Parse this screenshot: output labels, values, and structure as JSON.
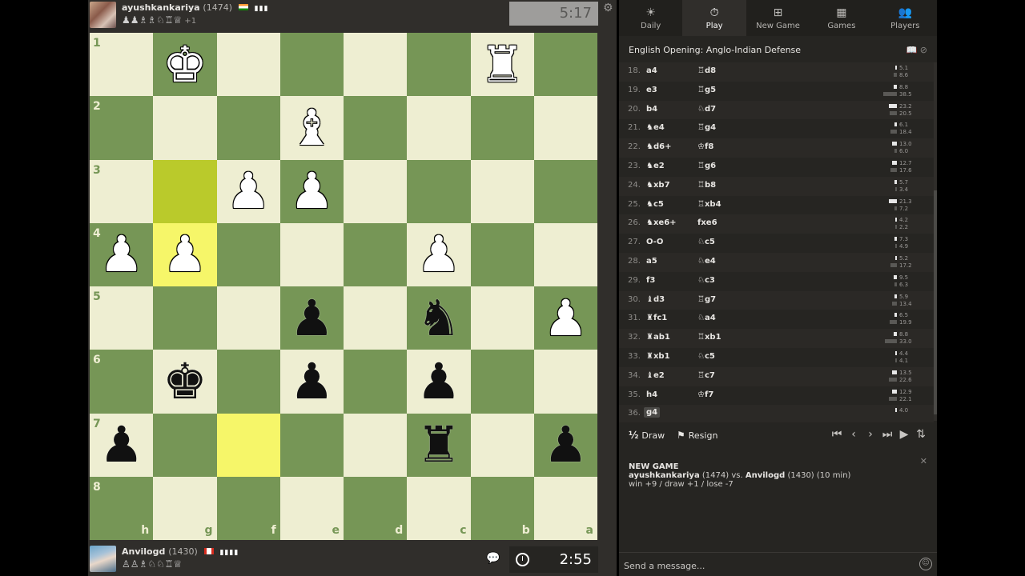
{
  "top_player": {
    "name": "ayushkankariya",
    "rating": "(1474)",
    "captured": "♟♟♗♗♘♖♕",
    "advantage": "+1",
    "clock": "5:17"
  },
  "bottom_player": {
    "name": "Anvilogd",
    "rating": "(1430)",
    "captured": "♙♙♗♘♘♖♕",
    "clock": "2:55"
  },
  "board": {
    "ranks": [
      "1",
      "2",
      "3",
      "4",
      "5",
      "6",
      "7",
      "8"
    ],
    "files": [
      "h",
      "g",
      "f",
      "e",
      "d",
      "c",
      "b",
      "a"
    ],
    "rows": [
      [
        "",
        "wk",
        "",
        "",
        "",
        "",
        "wr",
        ""
      ],
      [
        "",
        "",
        "",
        "wb",
        "",
        "",
        "",
        ""
      ],
      [
        "",
        "",
        "wp",
        "wp",
        "",
        "",
        "",
        ""
      ],
      [
        "wp",
        "wp",
        "",
        "",
        "",
        "wp",
        "",
        ""
      ],
      [
        "",
        "",
        "",
        "bp",
        "",
        "bn",
        "",
        "wp"
      ],
      [
        "",
        "bk",
        "",
        "bp",
        "",
        "bp",
        "",
        ""
      ],
      [
        "bp",
        "",
        "",
        "",
        "",
        "br",
        "",
        "bp"
      ],
      [
        "",
        "",
        "",
        "",
        "",
        "",
        "",
        ""
      ]
    ],
    "highlight_squares": [
      "2,1",
      "3,1",
      "6,2"
    ],
    "colors": {
      "light": "#eeeed2",
      "dark": "#769656",
      "highlight_light": "#f6f669",
      "highlight_dark": "#baca2b"
    }
  },
  "nav_tabs": [
    {
      "label": "Daily",
      "icon": "sun-icon"
    },
    {
      "label": "Play",
      "icon": "stopwatch-icon"
    },
    {
      "label": "New Game",
      "icon": "plus-icon"
    },
    {
      "label": "Games",
      "icon": "chessboard-icon"
    },
    {
      "label": "Players",
      "icon": "people-icon"
    }
  ],
  "opening": "English Opening: Anglo-Indian Defense",
  "moves": [
    {
      "n": "18.",
      "w": "a4",
      "b": "♖d8",
      "wt": "5.1",
      "bt": "8.6",
      "wv": 5.1,
      "bv": 8.6
    },
    {
      "n": "19.",
      "w": "e3",
      "b": "♖g5",
      "wt": "8.8",
      "bt": "38.5",
      "wv": 8.8,
      "bv": 38.5
    },
    {
      "n": "20.",
      "w": "b4",
      "b": "♘d7",
      "wt": "23.2",
      "bt": "20.5",
      "wv": 23.2,
      "bv": 20.5
    },
    {
      "n": "21.",
      "w": "♞e4",
      "b": "♖g4",
      "wt": "6.1",
      "bt": "18.4",
      "wv": 6.1,
      "bv": 18.4
    },
    {
      "n": "22.",
      "w": "♞d6+",
      "b": "♔f8",
      "wt": "13.0",
      "bt": "6.0",
      "wv": 13.0,
      "bv": 6.0
    },
    {
      "n": "23.",
      "w": "♞e2",
      "b": "♖g6",
      "wt": "12.7",
      "bt": "17.6",
      "wv": 12.7,
      "bv": 17.6
    },
    {
      "n": "24.",
      "w": "♞xb7",
      "b": "♖b8",
      "wt": "5.7",
      "bt": "3.4",
      "wv": 5.7,
      "bv": 3.4
    },
    {
      "n": "25.",
      "w": "♞c5",
      "b": "♖xb4",
      "wt": "21.3",
      "bt": "7.2",
      "wv": 21.3,
      "bv": 7.2
    },
    {
      "n": "26.",
      "w": "♞xe6+",
      "b": "fxe6",
      "wt": "4.2",
      "bt": "2.2",
      "wv": 4.2,
      "bv": 2.2
    },
    {
      "n": "27.",
      "w": "O-O",
      "b": "♘c5",
      "wt": "7.3",
      "bt": "4.9",
      "wv": 7.3,
      "bv": 4.9
    },
    {
      "n": "28.",
      "w": "a5",
      "b": "♘e4",
      "wt": "5.2",
      "bt": "17.2",
      "wv": 5.2,
      "bv": 17.2
    },
    {
      "n": "29.",
      "w": "f3",
      "b": "♘c3",
      "wt": "9.5",
      "bt": "6.3",
      "wv": 9.5,
      "bv": 6.3
    },
    {
      "n": "30.",
      "w": "♝d3",
      "b": "♖g7",
      "wt": "5.9",
      "bt": "13.4",
      "wv": 5.9,
      "bv": 13.4
    },
    {
      "n": "31.",
      "w": "♜fc1",
      "b": "♘a4",
      "wt": "6.5",
      "bt": "19.9",
      "wv": 6.5,
      "bv": 19.9
    },
    {
      "n": "32.",
      "w": "♜ab1",
      "b": "♖xb1",
      "wt": "8.8",
      "bt": "33.0",
      "wv": 8.8,
      "bv": 33.0
    },
    {
      "n": "33.",
      "w": "♜xb1",
      "b": "♘c5",
      "wt": "4.4",
      "bt": "4.1",
      "wv": 4.4,
      "bv": 4.1
    },
    {
      "n": "34.",
      "w": "♝e2",
      "b": "♖c7",
      "wt": "13.5",
      "bt": "22.6",
      "wv": 13.5,
      "bv": 22.6
    },
    {
      "n": "35.",
      "w": "h4",
      "b": "♔f7",
      "wt": "12.9",
      "bt": "22.1",
      "wv": 12.9,
      "bv": 22.1
    },
    {
      "n": "36.",
      "w": "g4",
      "b": "",
      "wt": "4.0",
      "bt": "",
      "wv": 4.0,
      "bv": 0
    }
  ],
  "controls": {
    "draw_icon": "½",
    "draw": "Draw",
    "resign": "Resign"
  },
  "new_game": {
    "heading": "NEW GAME",
    "player1": "ayushkankariya",
    "p1_rating": "(1474)",
    "vs": "vs.",
    "player2": "Anvilogd",
    "p2_rating_time": "(1430) (10 min)",
    "stakes": "win +9 / draw +1 / lose -7"
  },
  "chat": {
    "placeholder": "Send a message..."
  }
}
